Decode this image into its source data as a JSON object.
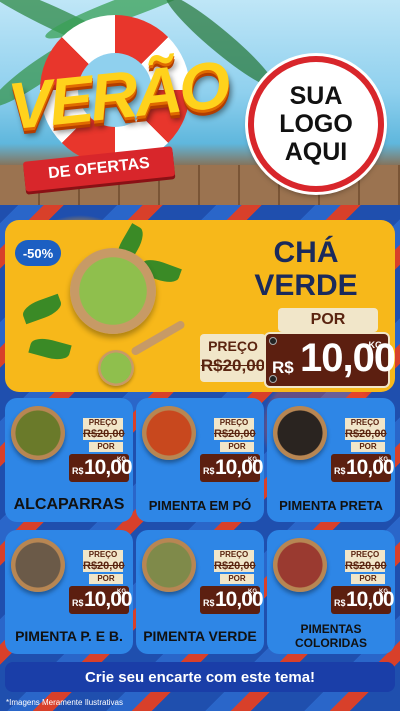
{
  "header": {
    "headline": "VERÃO",
    "subtitle": "DE OFERTAS",
    "logo_placeholder": [
      "SUA",
      "LOGO",
      "AQUI"
    ]
  },
  "featured": {
    "discount": "-50%",
    "title_line1": "CHÁ",
    "title_line2": "VERDE",
    "por_label": "POR",
    "preco_label": "PREÇO",
    "old_price": "R$20,00",
    "currency": "R$",
    "price": "10,00",
    "unit": "KG"
  },
  "products": [
    {
      "name": "ALCAPARRAS",
      "preco_label": "PREÇO",
      "old_price": "R$20,00",
      "por_label": "POR",
      "currency": "R$",
      "price": "10,00",
      "unit": "KG",
      "color": "#6a7a2a"
    },
    {
      "name": "PIMENTA EM PÓ",
      "preco_label": "PREÇO",
      "old_price": "R$20,00",
      "por_label": "POR",
      "currency": "R$",
      "price": "10,00",
      "unit": "KG",
      "color": "#c8481e"
    },
    {
      "name": "PIMENTA PRETA",
      "preco_label": "PREÇO",
      "old_price": "R$20,00",
      "por_label": "POR",
      "currency": "R$",
      "price": "10,00",
      "unit": "KG",
      "color": "#2a2420"
    },
    {
      "name": "PIMENTA P. E B.",
      "preco_label": "PREÇO",
      "old_price": "R$20,00",
      "por_label": "POR",
      "currency": "R$",
      "price": "10,00",
      "unit": "KG",
      "color": "#6b5a48"
    },
    {
      "name": "PIMENTA VERDE",
      "preco_label": "PREÇO",
      "old_price": "R$20,00",
      "por_label": "POR",
      "currency": "R$",
      "price": "10,00",
      "unit": "KG",
      "color": "#7f8a4a"
    },
    {
      "name_line1": "PIMENTAS",
      "name_line2": "COLORIDAS",
      "preco_label": "PREÇO",
      "old_price": "R$20,00",
      "por_label": "POR",
      "currency": "R$",
      "price": "10,00",
      "unit": "KG",
      "color": "#9a3a30"
    }
  ],
  "footer": {
    "cta": "Crie seu encarte com este tema!",
    "disclaimer": "*Imagens Meramente Ilustrativas"
  }
}
